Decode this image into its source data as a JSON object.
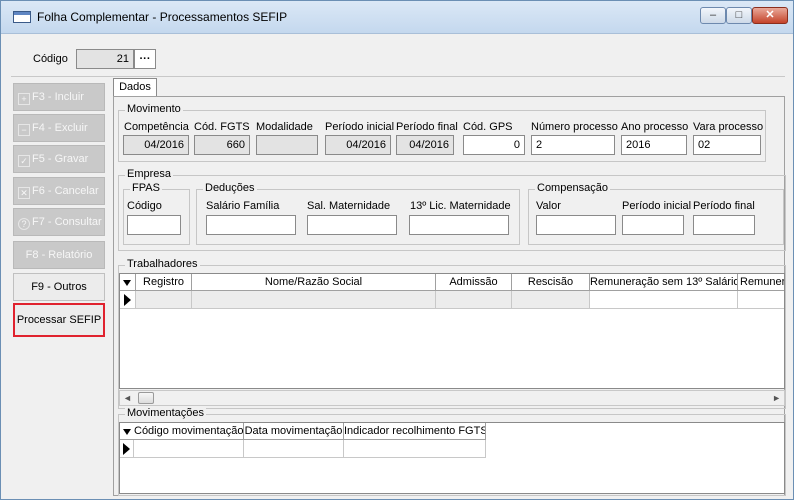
{
  "window": {
    "title": "Folha Complementar - Processamentos SEFIP",
    "minimize": "–",
    "maximize": "□",
    "close": "✕"
  },
  "codigo": {
    "label": "Código",
    "value": "21",
    "lookup": "···"
  },
  "sidebar": {
    "items": [
      {
        "label": "F3 - Incluir",
        "icon": "plus-icon",
        "glyph": "+"
      },
      {
        "label": "F4 - Excluir",
        "icon": "minus-icon",
        "glyph": "−"
      },
      {
        "label": "F5 - Gravar",
        "icon": "check-icon",
        "glyph": "✓"
      },
      {
        "label": "F6 - Cancelar",
        "icon": "x-icon",
        "glyph": "✕"
      },
      {
        "label": "F7 - Consultar",
        "icon": "question-icon",
        "glyph": "?"
      },
      {
        "label": "F8 - Relatório"
      },
      {
        "label": "F9 - Outros"
      },
      {
        "label": "Processar SEFIP"
      }
    ]
  },
  "tab": {
    "label": "Dados"
  },
  "movimento": {
    "title": "Movimento",
    "competencia": {
      "label": "Competência",
      "value": "04/2016"
    },
    "cod_fgts": {
      "label": "Cód. FGTS",
      "value": "660"
    },
    "modalidade": {
      "label": "Modalidade",
      "value": ""
    },
    "periodo_inicial": {
      "label": "Período inicial",
      "value": "04/2016"
    },
    "periodo_final": {
      "label": "Período final",
      "value": "04/2016"
    },
    "cod_gps": {
      "label": "Cód. GPS",
      "value": "0"
    },
    "numero_processo": {
      "label": "Número processo",
      "value": "2"
    },
    "ano_processo": {
      "label": "Ano processo",
      "value": "2016"
    },
    "vara_processo": {
      "label": "Vara processo",
      "value": "02"
    }
  },
  "empresa": {
    "title": "Empresa",
    "fpas": {
      "title": "FPAS",
      "codigo_label": "Código",
      "codigo_value": ""
    },
    "deducoes": {
      "title": "Deduções",
      "salario_familia": "Salário Família",
      "sal_maternidade": "Sal. Maternidade",
      "lic_maternidade": "13º Lic. Maternidade"
    },
    "compensacao": {
      "title": "Compensação",
      "valor": "Valor",
      "periodo_inicial": "Período inicial",
      "periodo_final": "Período final"
    }
  },
  "trabalhadores": {
    "title": "Trabalhadores",
    "columns": [
      "Registro",
      "Nome/Razão Social",
      "Admissão",
      "Rescisão",
      "Remuneração sem 13º Salário",
      "Remunera"
    ]
  },
  "movimentacoes": {
    "title": "Movimentações",
    "columns": [
      "Código movimentação",
      "Data movimentação",
      "Indicador recolhimento FGTS"
    ]
  }
}
